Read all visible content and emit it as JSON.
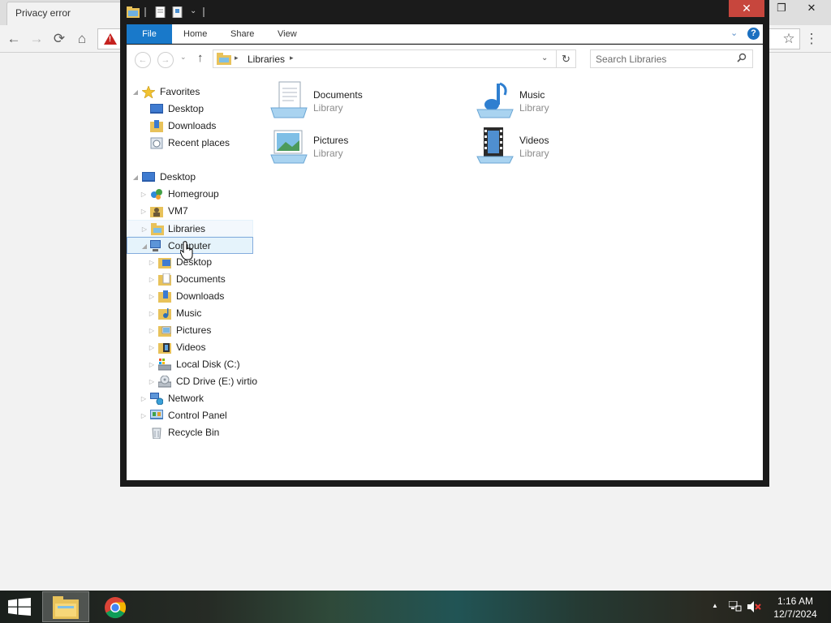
{
  "browser": {
    "tab_title": "Privacy error",
    "back_glyph": "←",
    "forward_glyph": "→",
    "reload_glyph": "⟳",
    "home_glyph": "⌂",
    "star_glyph": "☆",
    "menu_glyph": "⋮",
    "warning_glyph": "!",
    "restore_glyph": "❐",
    "close_glyph": "✕"
  },
  "explorer": {
    "window_close_glyph": "✕",
    "ribbon_tabs": [
      "File",
      "Home",
      "Share",
      "View"
    ],
    "collapse_glyph": "⌄",
    "help_glyph": "?",
    "address": {
      "path": "Libraries",
      "chevron": "▸",
      "dropdown": "⌄"
    },
    "refresh_glyph": "↻",
    "up_glyph": "↑",
    "back_glyph": "←",
    "forward_glyph": "→",
    "recent_glyph": "⌄",
    "search_placeholder": "Search Libraries",
    "search_glyph": "⚲",
    "nav_tree": {
      "favorites": {
        "label": "Favorites",
        "children": [
          "Desktop",
          "Downloads",
          "Recent places"
        ]
      },
      "desktop_root": "Desktop",
      "desktop_children": [
        "Homegroup",
        "VM7",
        "Libraries",
        "Computer"
      ],
      "computer_children": [
        "Desktop",
        "Documents",
        "Downloads",
        "Music",
        "Pictures",
        "Videos",
        "Local Disk (C:)",
        "CD Drive (E:) virtio"
      ],
      "after_computer": [
        "Network",
        "Control Panel",
        "Recycle Bin"
      ]
    },
    "libraries": [
      {
        "name": "Documents",
        "type": "Library",
        "icon": "documents-library-icon"
      },
      {
        "name": "Music",
        "type": "Library",
        "icon": "music-library-icon"
      },
      {
        "name": "Pictures",
        "type": "Library",
        "icon": "pictures-library-icon"
      },
      {
        "name": "Videos",
        "type": "Library",
        "icon": "videos-library-icon"
      }
    ],
    "selected_item": "Computer",
    "hover_item": "Libraries"
  },
  "taskbar": {
    "time": "1:16 AM",
    "date": "12/7/2024",
    "tray_arrow": "▲",
    "pinned": [
      "file-explorer-icon",
      "chrome-icon"
    ]
  }
}
